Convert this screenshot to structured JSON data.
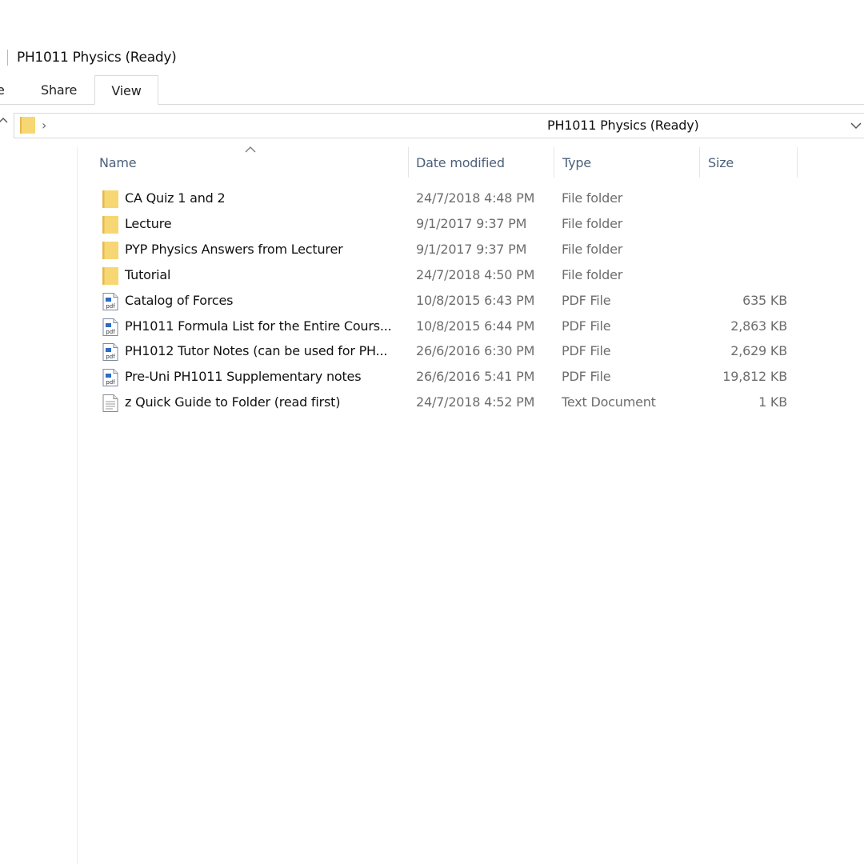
{
  "window": {
    "title": "PH1011 Physics (Ready)"
  },
  "ribbon": {
    "tabs": [
      {
        "label": "e"
      },
      {
        "label": "Share"
      },
      {
        "label": "View"
      }
    ]
  },
  "address": {
    "path": "PH1011 Physics (Ready)",
    "chevron": "›"
  },
  "columns": {
    "name": "Name",
    "date": "Date modified",
    "type": "Type",
    "size": "Size"
  },
  "files": [
    {
      "name": "CA Quiz 1 and 2",
      "date": "24/7/2018 4:48 PM",
      "type": "File folder",
      "size": "",
      "icon": "folder-icon"
    },
    {
      "name": "Lecture",
      "date": "9/1/2017 9:37 PM",
      "type": "File folder",
      "size": "",
      "icon": "folder-icon"
    },
    {
      "name": "PYP Physics Answers from Lecturer",
      "date": "9/1/2017 9:37 PM",
      "type": "File folder",
      "size": "",
      "icon": "folder-icon"
    },
    {
      "name": "Tutorial",
      "date": "24/7/2018 4:50 PM",
      "type": "File folder",
      "size": "",
      "icon": "folder-icon"
    },
    {
      "name": "Catalog of Forces",
      "date": "10/8/2015 6:43 PM",
      "type": "PDF File",
      "size": "635 KB",
      "icon": "pdf-file-icon"
    },
    {
      "name": "PH1011 Formula List for the Entire Cours...",
      "date": "10/8/2015 6:44 PM",
      "type": "PDF File",
      "size": "2,863 KB",
      "icon": "pdf-file-icon"
    },
    {
      "name": "PH1012 Tutor Notes (can be used for PH...",
      "date": "26/6/2016 6:30 PM",
      "type": "PDF File",
      "size": "2,629 KB",
      "icon": "pdf-file-icon"
    },
    {
      "name": "Pre-Uni PH1011 Supplementary notes",
      "date": "26/6/2016 5:41 PM",
      "type": "PDF File",
      "size": "19,812 KB",
      "icon": "pdf-file-icon"
    },
    {
      "name": "z Quick Guide to Folder (read first)",
      "date": "24/7/2018 4:52 PM",
      "type": "Text Document",
      "size": "1 KB",
      "icon": "text-file-icon"
    }
  ],
  "colors": {
    "folder": "#f7d774",
    "folder_dark": "#e6b94a",
    "header_text": "#4c607a",
    "meta_text": "#6d6d6d"
  }
}
